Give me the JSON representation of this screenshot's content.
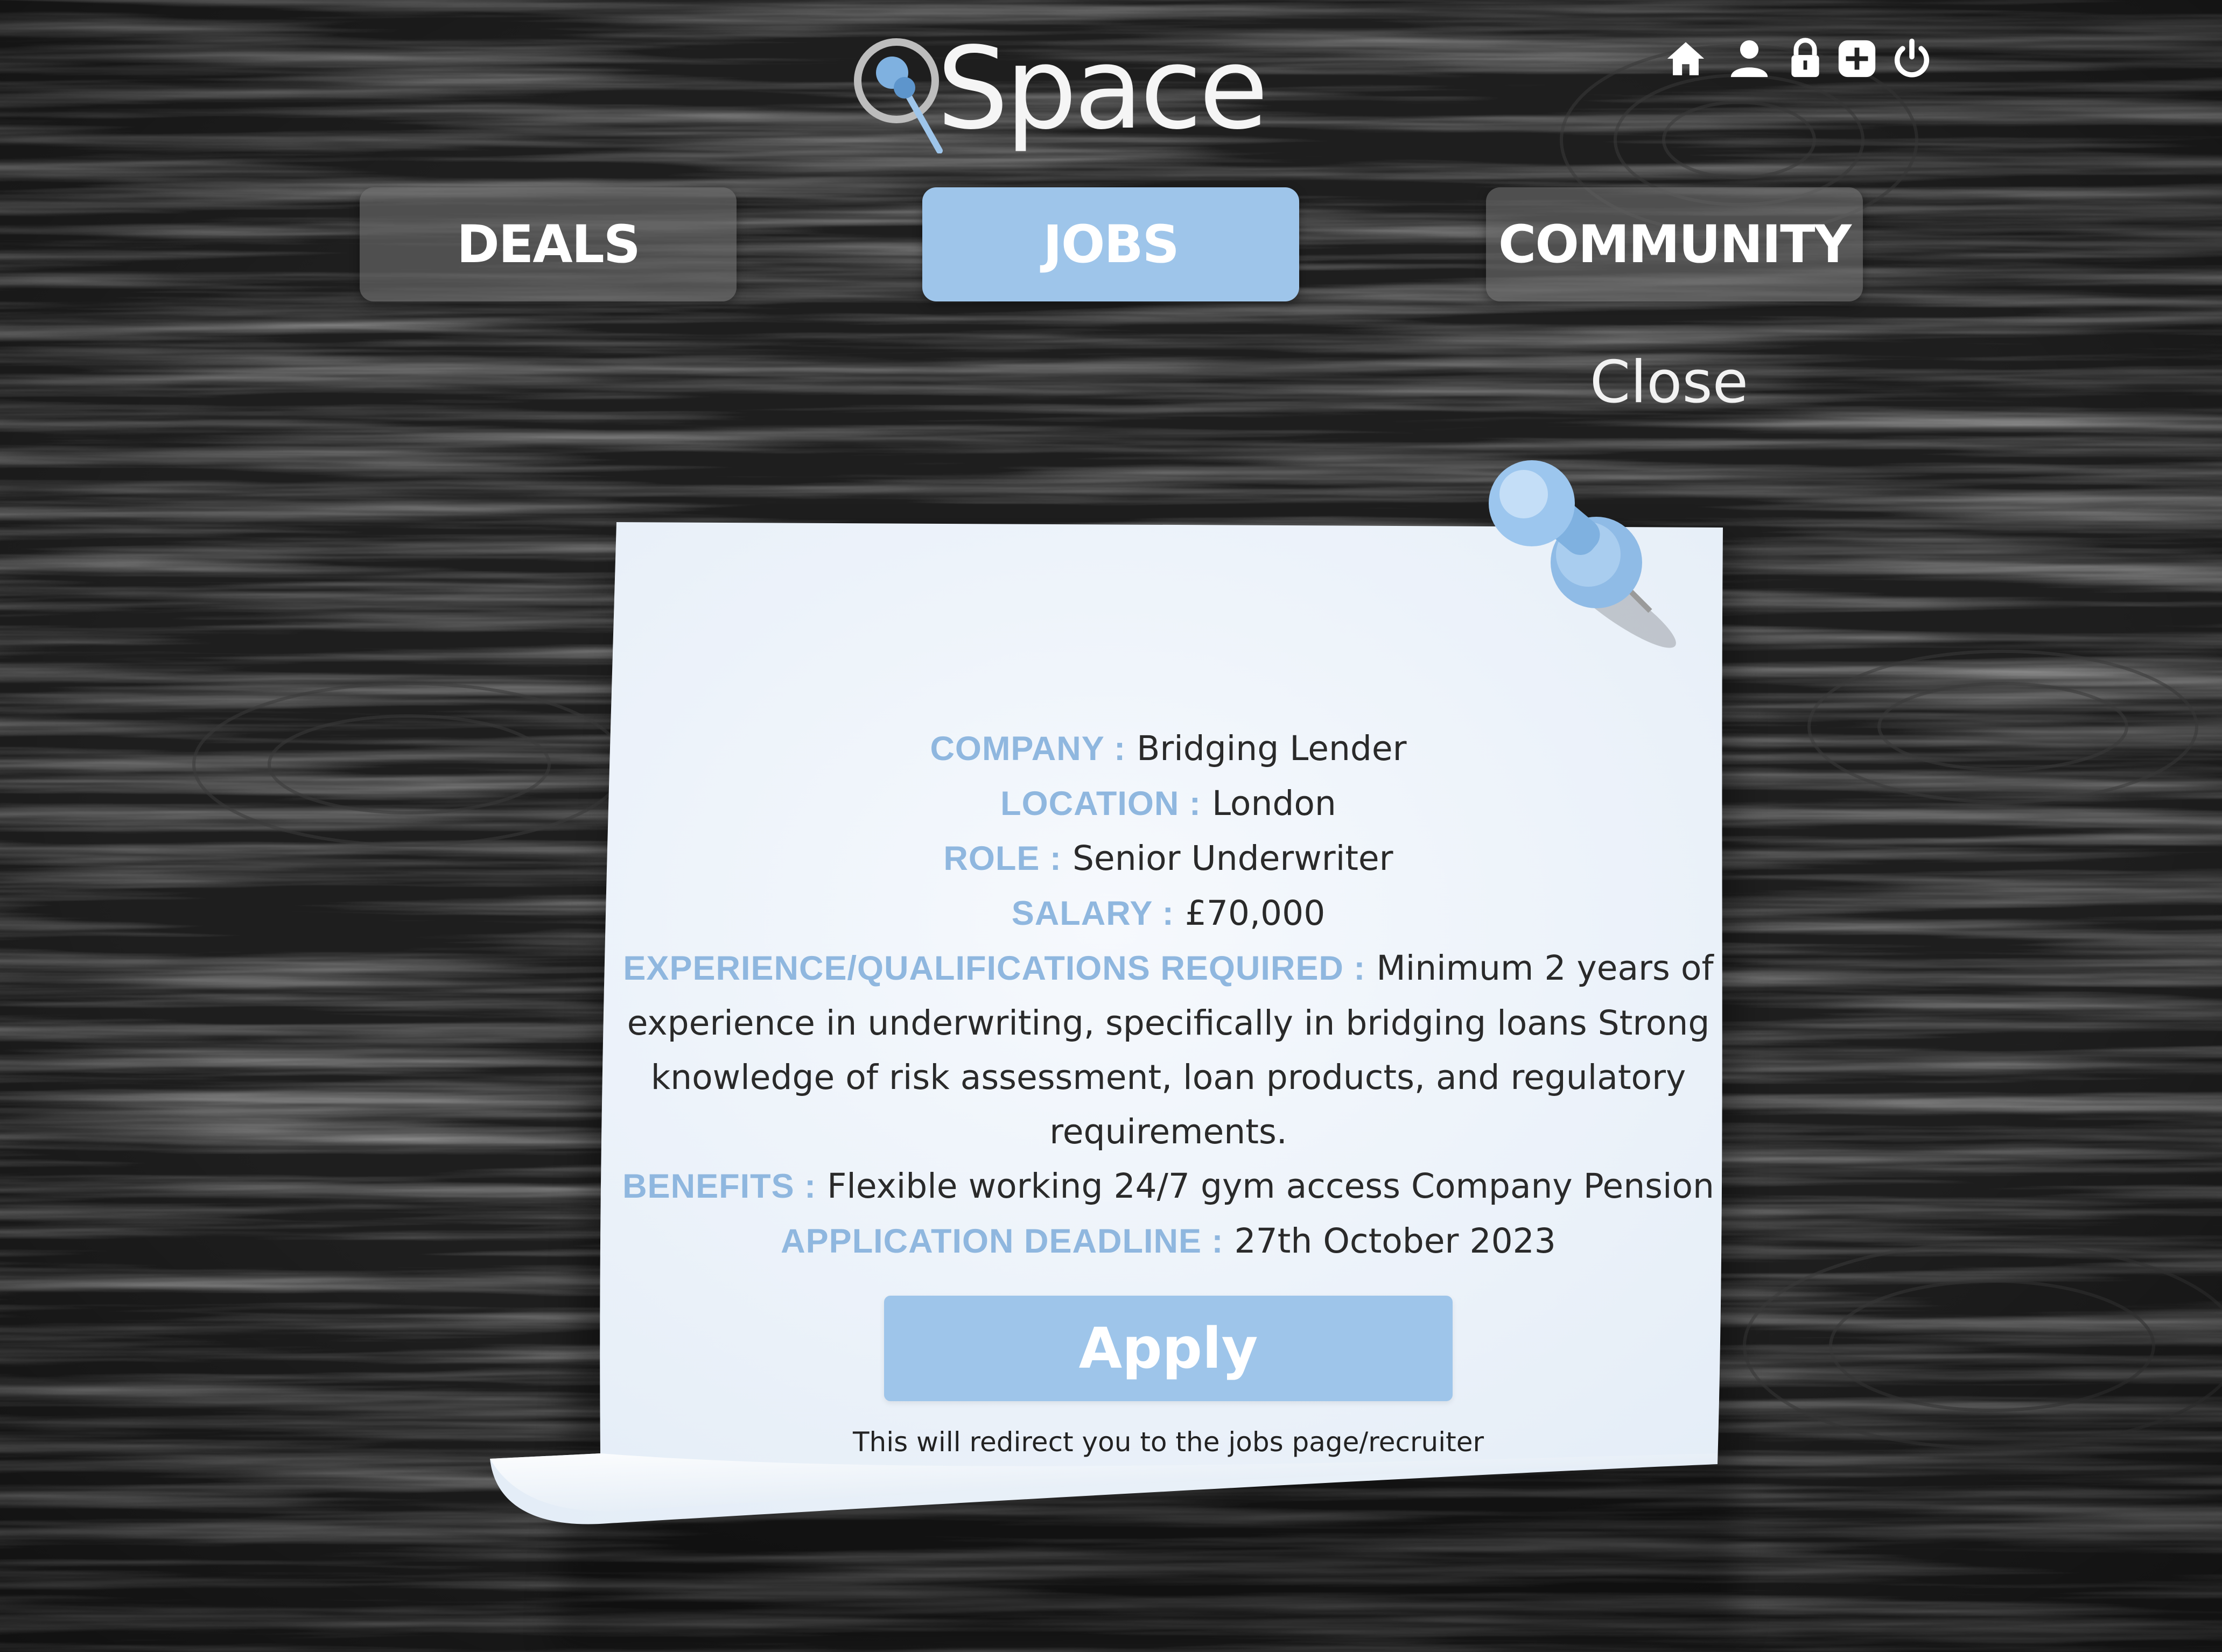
{
  "app": {
    "logo_text": "Space"
  },
  "colors": {
    "accent": "#9ec5ea",
    "label": "#8fb7df",
    "paper": "#eef4fb",
    "wood": "#232323",
    "tab_inactive": "#6e6e6e"
  },
  "top_icons": [
    {
      "name": "home-icon"
    },
    {
      "name": "user-icon"
    },
    {
      "name": "lock-icon"
    },
    {
      "name": "add-icon"
    },
    {
      "name": "power-icon"
    }
  ],
  "nav": {
    "tabs": [
      {
        "label": "DEALS",
        "active": false
      },
      {
        "label": "JOBS",
        "active": true
      },
      {
        "label": "COMMUNITY",
        "active": false
      }
    ],
    "close_label": "Close"
  },
  "job": {
    "company": {
      "label": "COMPANY :",
      "value": "Bridging Lender"
    },
    "location": {
      "label": "LOCATION :",
      "value": "London"
    },
    "role": {
      "label": "ROLE :",
      "value": "Senior Underwriter"
    },
    "salary": {
      "label": "SALARY :",
      "value": "£70,000"
    },
    "experience": {
      "label": "EXPERIENCE/QUALIFICATIONS REQUIRED :",
      "value": "Minimum 2 years of experience in underwriting, specifically in bridging loans Strong knowledge of risk assessment, loan products, and regulatory requirements."
    },
    "benefits": {
      "label": "BENEFITS :",
      "value": "Flexible working 24/7 gym access Company Pension"
    },
    "deadline": {
      "label": "APPLICATION DEADLINE :",
      "value": "27th October 2023"
    }
  },
  "apply": {
    "label": "Apply",
    "note": "This will redirect you to the jobs page/recruiter"
  }
}
